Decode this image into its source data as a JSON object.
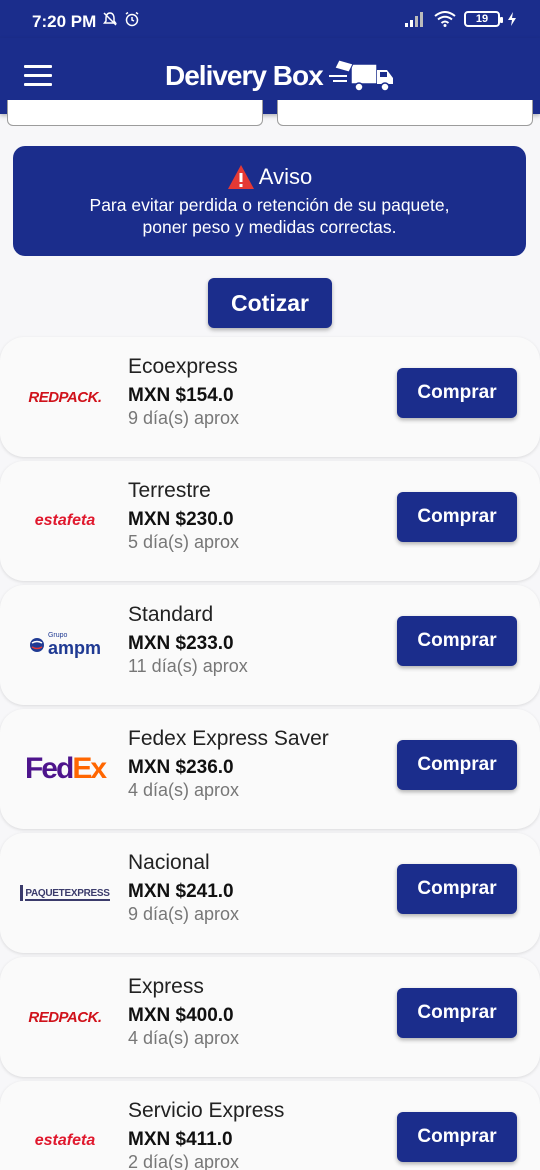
{
  "status_bar": {
    "time": "7:20 PM",
    "battery": "19"
  },
  "app_bar": {
    "brand": "Delivery Box"
  },
  "notice": {
    "title": "Aviso",
    "line1": "Para evitar perdida o retención de su paquete,",
    "line2": "poner peso y medidas correctas."
  },
  "quote_button": "Cotizar",
  "buy_label": "Comprar",
  "carriers": [
    {
      "logo": "REDPACK.",
      "service": "Ecoexpress",
      "price": "MXN $154.0",
      "days": "9 día(s) aprox"
    },
    {
      "logo": "estafeta",
      "service": "Terrestre",
      "price": "MXN $230.0",
      "days": "5 día(s) aprox"
    },
    {
      "logo": "ampm",
      "logo_group": "Grupo",
      "service": "Standard",
      "price": "MXN $233.0",
      "days": "11 día(s) aprox"
    },
    {
      "logo": "FedEx",
      "service": "Fedex Express Saver",
      "price": "MXN $236.0",
      "days": "4 día(s) aprox"
    },
    {
      "logo": "PAQUETEXPRESS",
      "service": "Nacional",
      "price": "MXN $241.0",
      "days": "9 día(s) aprox"
    },
    {
      "logo": "REDPACK.",
      "service": "Express",
      "price": "MXN $400.0",
      "days": "4 día(s) aprox"
    },
    {
      "logo": "estafeta",
      "service": "Servicio Express",
      "price": "MXN $411.0",
      "days": "2 día(s) aprox"
    }
  ],
  "colors": {
    "primary": "#1b2d8c",
    "warning": "#e53935"
  }
}
